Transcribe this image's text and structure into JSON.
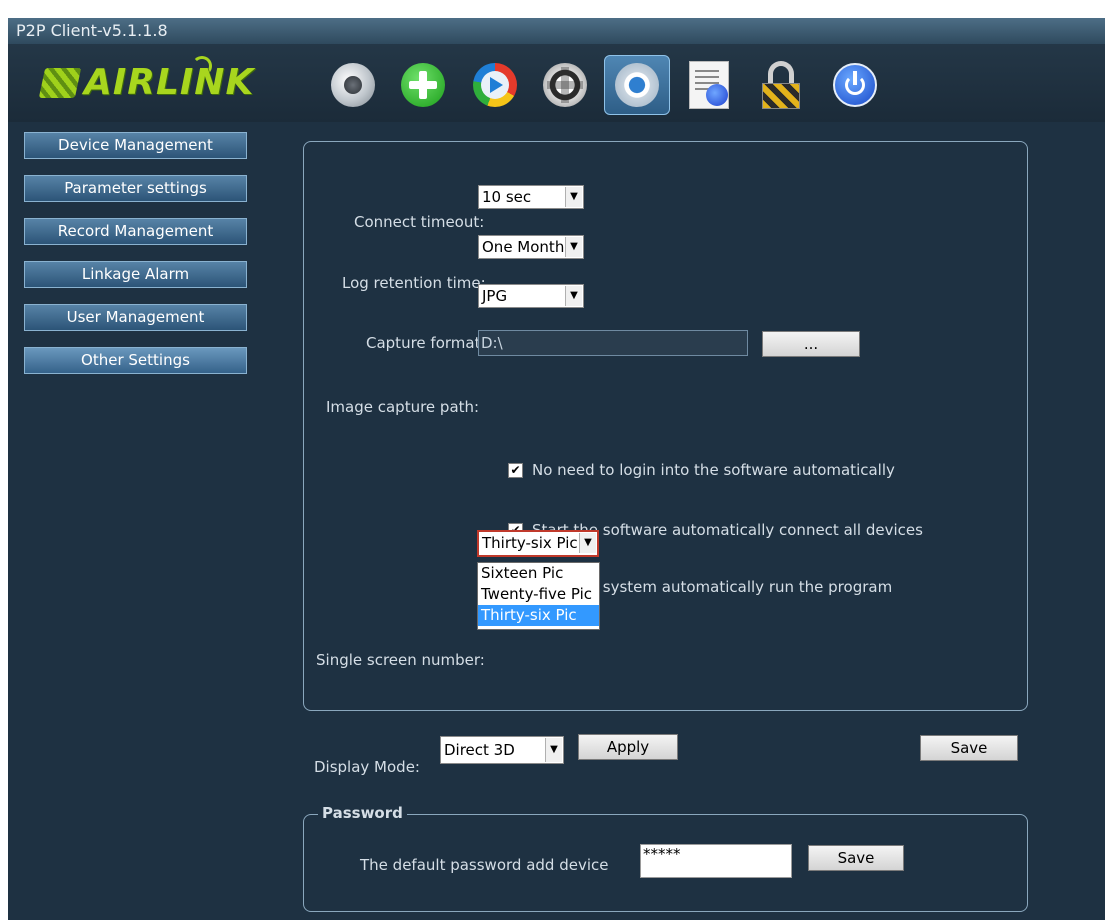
{
  "window": {
    "title": "P2P Client-v5.1.1.8"
  },
  "logo": {
    "text": "AIRLINK"
  },
  "toolbar": {
    "icons": [
      "webcam-icon",
      "add-icon",
      "play-icon",
      "ptz-icon",
      "settings-icon",
      "log-icon",
      "lock-icon",
      "power-icon"
    ],
    "active": "settings-icon"
  },
  "sidebar": {
    "items": [
      {
        "label": "Device Management"
      },
      {
        "label": "Parameter settings"
      },
      {
        "label": "Record Management"
      },
      {
        "label": "Linkage Alarm"
      },
      {
        "label": "User Management"
      },
      {
        "label": "Other Settings"
      }
    ],
    "selected": "Other Settings"
  },
  "settings": {
    "connect_timeout_label": "Connect timeout:",
    "connect_timeout_value": "10 sec",
    "log_retention_label": "Log retention time:",
    "log_retention_value": "One Month",
    "capture_format_label": "Capture format:",
    "capture_format_value": "JPG",
    "capture_path_label": "Image capture path:",
    "capture_path_value": "D:\\",
    "browse_label": "...",
    "checkbox_1": "No need to login into the software automatically",
    "checkbox_2": "Start the software automatically connect all devices",
    "checkbox_3": "Start the system automatically run the program",
    "single_screen_label": "Single screen number:",
    "single_screen_value": "Thirty-six Pic",
    "single_screen_options": [
      "Sixteen Pic",
      "Twenty-five Pic",
      "Thirty-six Pic"
    ],
    "single_screen_highlighted": "Thirty-six Pic"
  },
  "display": {
    "label": "Display Mode:",
    "value": "Direct 3D",
    "apply_label": "Apply",
    "save_label": "Save"
  },
  "password": {
    "legend": "Password",
    "label": "The default password add device",
    "value": "*****",
    "save_label": "Save"
  },
  "colors": {
    "background": "#1e3142",
    "accent": "#3399ff",
    "logo": "#a8d61e",
    "sidebar_button": "#3c6a91"
  }
}
